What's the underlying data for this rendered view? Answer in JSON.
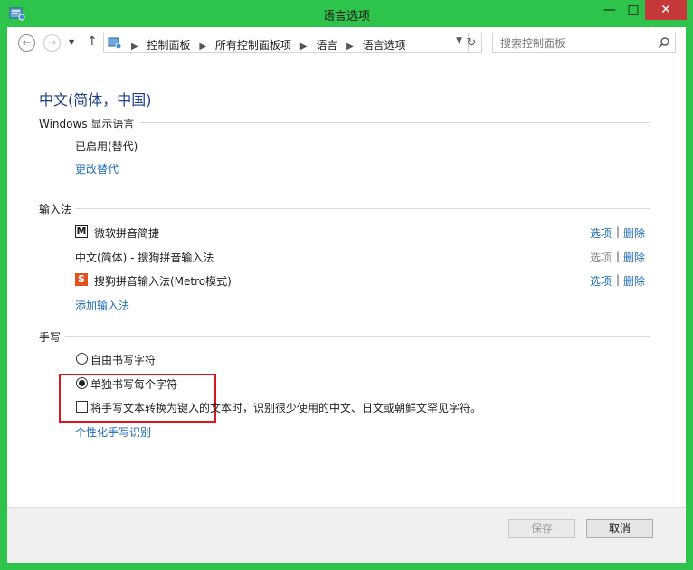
{
  "window": {
    "title": "语言选项"
  },
  "nav": {
    "breadcrumb": [
      "控制面板",
      "所有控制面板项",
      "语言",
      "语言选项"
    ],
    "search_placeholder": "搜索控制面板"
  },
  "page": {
    "heading": "中文(简体，中国)",
    "display_language": {
      "title": "Windows 显示语言",
      "status": "已启用(替代)",
      "change_link": "更改替代"
    },
    "input_methods": {
      "title": "输入法",
      "items": [
        {
          "name": "微软拼音简捷",
          "icon": "m-ime-icon",
          "options": "选项",
          "remove": "删除",
          "options_enabled": true
        },
        {
          "name": "中文(简体) - 搜狗拼音输入法",
          "icon": "",
          "options": "选项",
          "remove": "删除",
          "options_enabled": false
        },
        {
          "name": "搜狗拼音输入法(Metro模式)",
          "icon": "sogou-icon",
          "options": "选项",
          "remove": "删除",
          "options_enabled": true
        }
      ],
      "add_link": "添加输入法"
    },
    "handwriting": {
      "title": "手写",
      "radio_free": "自由书写字符",
      "radio_single": "单独书写每个字符",
      "selected": "单独书写每个字符",
      "checkbox_label": "将手写文本转换为键入的文本时，识别很少使用的中文、日文或朝鲜文罕见字符。",
      "checkbox_checked": false,
      "personalize_link": "个性化手写识别"
    }
  },
  "footer": {
    "save": "保存",
    "cancel": "取消"
  },
  "colors": {
    "frame": "#2ec34b",
    "link": "#1e6bb8",
    "heading": "#1e3e8a",
    "highlight": "#e0141b",
    "close": "#c7383a"
  }
}
